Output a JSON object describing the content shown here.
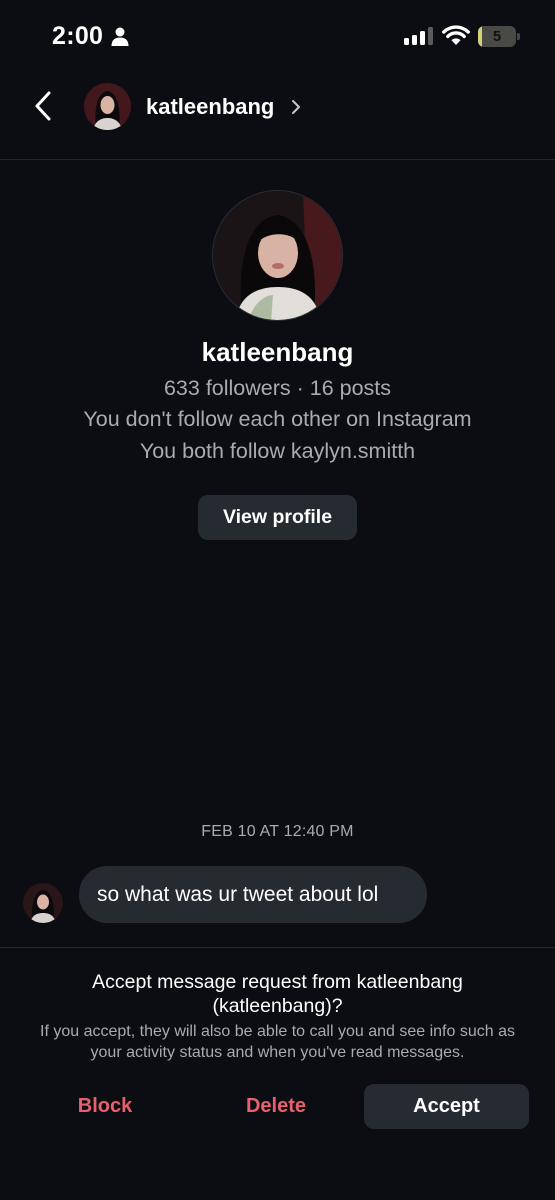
{
  "status_bar": {
    "time": "2:00",
    "battery_level": "5",
    "battery_fraction": 0.05
  },
  "header": {
    "username": "katleenbang"
  },
  "profile": {
    "username": "katleenbang",
    "stats": "633 followers · 16 posts",
    "follow_status": "You don't follow each other on Instagram",
    "mutual": "You both follow kaylyn.smitth",
    "view_profile_label": "View profile"
  },
  "conversation": {
    "timestamp": "FEB 10 AT 12:40 PM",
    "messages": [
      {
        "text": "so what was ur tweet about lol"
      }
    ]
  },
  "request": {
    "title": "Accept message request from katleenbang (katleenbang)?",
    "description": "If you accept, they will also be able to call you and see info such as your activity status and when you've read messages.",
    "block_label": "Block",
    "delete_label": "Delete",
    "accept_label": "Accept"
  },
  "colors": {
    "background": "#0b0d12",
    "surface": "#262a31",
    "secondary_text": "#a8abb2",
    "destructive": "#e8606d"
  }
}
